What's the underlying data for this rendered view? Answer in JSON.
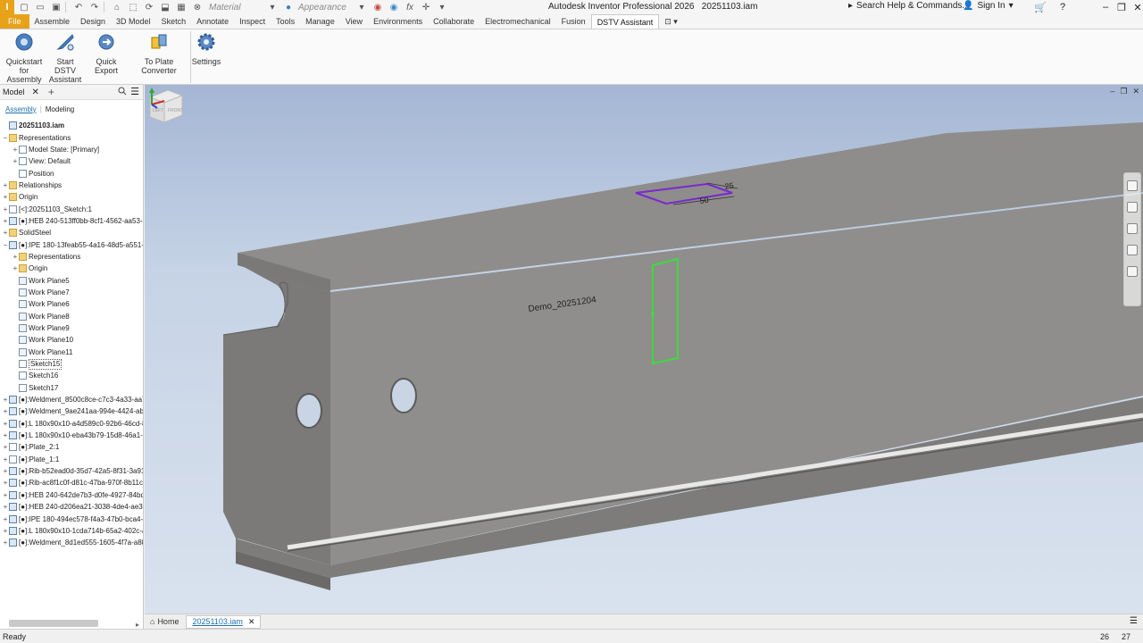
{
  "app": {
    "title": "Autodesk Inventor Professional 2026",
    "document_name": "20251103.iam",
    "logo_letter": "I"
  },
  "quick_access": {
    "material": "Material",
    "appearance": "Appearance"
  },
  "top_right": {
    "search": "Search Help & Commands...",
    "sign_in": "Sign In"
  },
  "ribbon_tabs": [
    "File",
    "Assemble",
    "Design",
    "3D Model",
    "Sketch",
    "Annotate",
    "Inspect",
    "Tools",
    "Manage",
    "View",
    "Environments",
    "Collaborate",
    "Electromechanical",
    "Fusion",
    "DSTV Assistant"
  ],
  "active_tab": "DSTV Assistant",
  "ribbon_buttons": [
    {
      "line1": "Quickstart",
      "line2": "for Assembly"
    },
    {
      "line1": "Start DSTV",
      "line2": "Assistant"
    },
    {
      "line1": "Quick Export",
      "line2": ""
    },
    {
      "line1": "To Plate Converter",
      "line2": ""
    },
    {
      "line1": "Settings",
      "line2": ""
    }
  ],
  "browser": {
    "tab_label": "Model",
    "mode_assembly": "Assembly",
    "mode_separator": "|",
    "mode_modeling": "Modeling",
    "tree": [
      {
        "label": "20251103.iam",
        "indent": 0,
        "exp": "",
        "icon": "asm",
        "bold": true
      },
      {
        "label": "Representations",
        "indent": 0,
        "exp": "−",
        "icon": "folder"
      },
      {
        "label": "Model State: [Primary]",
        "indent": 1,
        "exp": "+",
        "icon": "sketch"
      },
      {
        "label": "View: Default",
        "indent": 1,
        "exp": "+",
        "icon": "sketch"
      },
      {
        "label": "Position",
        "indent": 1,
        "exp": "",
        "icon": "sketch"
      },
      {
        "label": "Relationships",
        "indent": 0,
        "exp": "+",
        "icon": "folder"
      },
      {
        "label": "Origin",
        "indent": 0,
        "exp": "+",
        "icon": "folder"
      },
      {
        "label": "[<]:20251103_Sketch:1",
        "indent": 0,
        "exp": "+",
        "icon": "sketch"
      },
      {
        "label": "[●]:HEB 240-513ff0bb-8cf1-4562-aa53-c5",
        "indent": 0,
        "exp": "+",
        "icon": "asm"
      },
      {
        "label": "SolidSteel",
        "indent": 0,
        "exp": "+",
        "icon": "folder"
      },
      {
        "label": "[●]:IPE 180-13feab55-4a16-48d5-a551-10",
        "indent": 0,
        "exp": "−",
        "icon": "asm"
      },
      {
        "label": "Representations",
        "indent": 1,
        "exp": "+",
        "icon": "folder"
      },
      {
        "label": "Origin",
        "indent": 1,
        "exp": "+",
        "icon": "folder"
      },
      {
        "label": "Work Plane5",
        "indent": 1,
        "exp": "",
        "icon": "plane"
      },
      {
        "label": "Work Plane7",
        "indent": 1,
        "exp": "",
        "icon": "plane"
      },
      {
        "label": "Work Plane6",
        "indent": 1,
        "exp": "",
        "icon": "plane"
      },
      {
        "label": "Work Plane8",
        "indent": 1,
        "exp": "",
        "icon": "plane"
      },
      {
        "label": "Work Plane9",
        "indent": 1,
        "exp": "",
        "icon": "plane"
      },
      {
        "label": "Work Plane10",
        "indent": 1,
        "exp": "",
        "icon": "plane"
      },
      {
        "label": "Work Plane11",
        "indent": 1,
        "exp": "",
        "icon": "plane"
      },
      {
        "label": "Sketch15",
        "indent": 1,
        "exp": "",
        "icon": "sketch",
        "selected": true
      },
      {
        "label": "Sketch16",
        "indent": 1,
        "exp": "",
        "icon": "sketch"
      },
      {
        "label": "Sketch17",
        "indent": 1,
        "exp": "",
        "icon": "sketch"
      },
      {
        "label": "[●]:Weldment_8500c8ce-c7c3-4a33-aa7f-",
        "indent": 0,
        "exp": "+",
        "icon": "asm"
      },
      {
        "label": "[●]:Weldment_9ae241aa-994e-4424-ab69",
        "indent": 0,
        "exp": "+",
        "icon": "asm"
      },
      {
        "label": "[●]:L 180x90x10-a4d589c0-92b6-46cd-82",
        "indent": 0,
        "exp": "+",
        "icon": "asm"
      },
      {
        "label": "[●]:L 180x90x10-eba43b79-15d8-46a1-90",
        "indent": 0,
        "exp": "+",
        "icon": "asm"
      },
      {
        "label": "[●]:Plate_2:1",
        "indent": 0,
        "exp": "+",
        "icon": "sketch"
      },
      {
        "label": "[●]:Plate_1:1",
        "indent": 0,
        "exp": "+",
        "icon": "sketch"
      },
      {
        "label": "[●]:Rib-b52ead0d-35d7-42a5-8f31-3a919",
        "indent": 0,
        "exp": "+",
        "icon": "asm"
      },
      {
        "label": "[●]:Rib-ac8f1c0f-d81c-47ba-970f-8b11ce1",
        "indent": 0,
        "exp": "+",
        "icon": "asm"
      },
      {
        "label": "[●]:HEB 240-642de7b3-d0fe-4927-84bd-1",
        "indent": 0,
        "exp": "+",
        "icon": "asm"
      },
      {
        "label": "[●]:HEB 240-d206ea21-3038-4de4-ae36-6",
        "indent": 0,
        "exp": "+",
        "icon": "asm"
      },
      {
        "label": "[●]:IPE 180-494ec578-f4a3-47b0-bca4-47",
        "indent": 0,
        "exp": "+",
        "icon": "asm"
      },
      {
        "label": "[●]:L 180x90x10-1cda714b-65a2-402c-a4",
        "indent": 0,
        "exp": "+",
        "icon": "asm"
      },
      {
        "label": "[●]:Weldment_8d1ed555-1605-4f7a-a88a-",
        "indent": 0,
        "exp": "+",
        "icon": "asm"
      }
    ]
  },
  "viewport": {
    "engraving_text": "Demo_20251204",
    "dim_a": "25",
    "dim_b": "50",
    "cube_left": "LEFT",
    "cube_front": "FRONT",
    "sketch_color": "#3ddc3d",
    "slot_color": "#7a28d0",
    "beam_color": "#8a8987"
  },
  "doc_tabs": {
    "home": "Home",
    "active": "20251103.iam"
  },
  "status": {
    "text": "Ready",
    "n1": "26",
    "n2": "27"
  }
}
